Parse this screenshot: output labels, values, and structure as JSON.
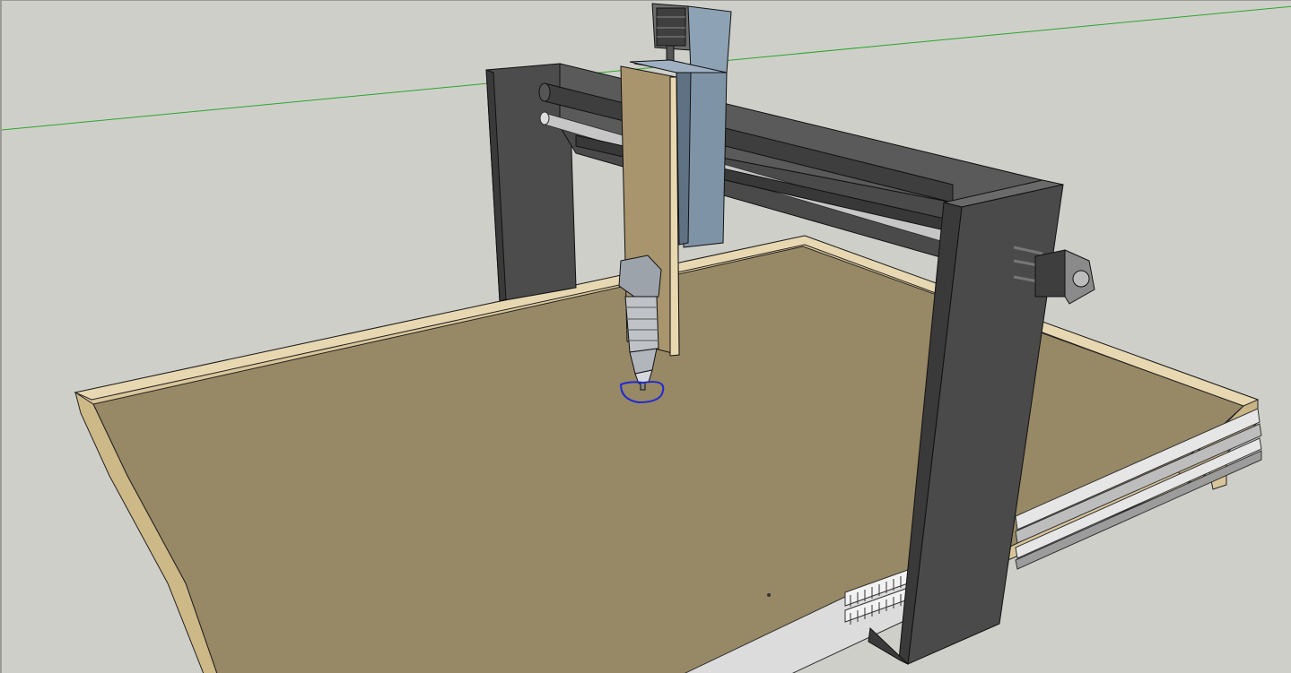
{
  "app": {
    "type": "3d-model-viewport"
  },
  "scene": {
    "model": "cnc-router",
    "parts": [
      "green-axis-line",
      "left-gantry-plate",
      "right-gantry-plate",
      "gantry-beam",
      "rail-rods",
      "z-axis-carriage",
      "z-axis-stepper-motor",
      "y-axis-stepper-motor",
      "spindle-router",
      "tool-selection-marker",
      "machine-bed",
      "bed-frame",
      "linear-rails"
    ]
  },
  "colors": {
    "background": "#cfcfca",
    "axis_green": "#2aa62a",
    "gantry_dark": "#5a5a5a",
    "gantry_side": "#454545",
    "bed_top": "#978866",
    "frame_wood": "#d9c59a",
    "carriage_blue": "#7f93a6",
    "plate_tan": "#a8946d",
    "spindle": "#bfc3c8",
    "selection_blue": "#1f2ad1",
    "rail_light": "#e6e6e6"
  }
}
